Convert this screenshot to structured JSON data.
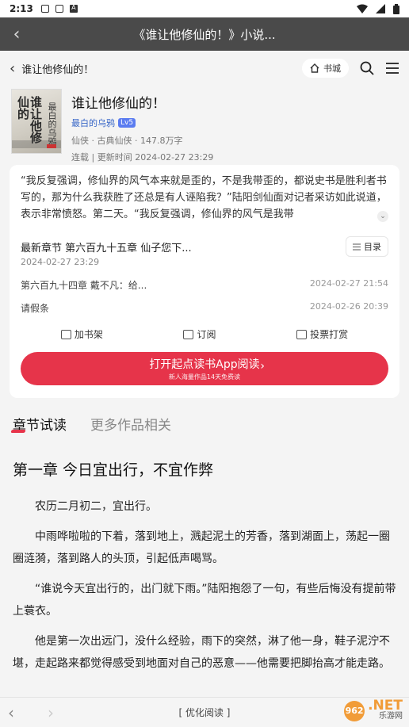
{
  "status": {
    "time": "2:13"
  },
  "browser": {
    "back_glyph": "‹",
    "title": "《谁让他修仙的！》小说..."
  },
  "header": {
    "back_glyph": "‹",
    "title": "谁让他修仙的！",
    "store_label": "书城"
  },
  "book": {
    "title": "谁让他修仙的！",
    "author": "最白的乌鸦",
    "level": "Lv5",
    "meta": "仙侠 · 古典仙侠 · 147.8万字",
    "status_update": "连载 | 更新时间 2024-02-27 23:29",
    "cover_title": "谁让他修仙的",
    "cover_subtitle": "最白的乌鸦"
  },
  "intro": "“我反复强调，修仙界的风气本来就是歪的，不是我带歪的，都说史书是胜利者书写的，那为什么我获胜了还总是有人诬陷我？”陆阳剑仙面对记者采访如此说道，表示非常愤怒。第二天。“我反复强调，修仙界的风气是我带",
  "latest": {
    "title": "最新章节 第六百九十五章 仙子您下...",
    "date": "2024-02-27 23:29",
    "toc_label": "目录",
    "chapters": [
      {
        "name": "第六百九十四章 戴不凡：给...",
        "date": "2024-02-27 21:54"
      },
      {
        "name": "请假条",
        "date": "2024-02-26 20:39"
      }
    ]
  },
  "actions": {
    "shelf": "加书架",
    "subscribe": "订阅",
    "vote": "投票打赏"
  },
  "open_app": {
    "main": "打开起点读书App阅读",
    "sub": "新人海量作品14天免费读"
  },
  "tabs": {
    "trial": "章节试读",
    "more": "更多作品相关"
  },
  "reading": {
    "chapter_title": "第一章 今日宜出行，不宜作弊",
    "paragraphs": [
      "农历二月初二，宜出行。",
      "中雨哗啦啦的下着，落到地上，溅起泥土的芳香，落到湖面上，荡起一圈圈涟漪，落到路人的头顶，引起低声喝骂。",
      "“谁说今天宜出行的，出门就下雨。”陆阳抱怨了一句，有些后悔没有提前带上蓑衣。",
      "他是第一次出远门，没什么经验，雨下的突然，淋了他一身，鞋子泥泞不堪，走起路来都觉得感受到地面对自己的恶意——他需要把脚抬高才能走路。"
    ]
  },
  "bottom": {
    "back": "‹",
    "forward": "›",
    "mode": "[ 优化阅读 ]"
  },
  "watermark": {
    "logo": "962",
    "text": ".NET",
    "sub": "乐游网"
  },
  "colors": {
    "accent": "#e6344a",
    "author": "#3766c7",
    "browser_bar": "#4a4a4a"
  }
}
